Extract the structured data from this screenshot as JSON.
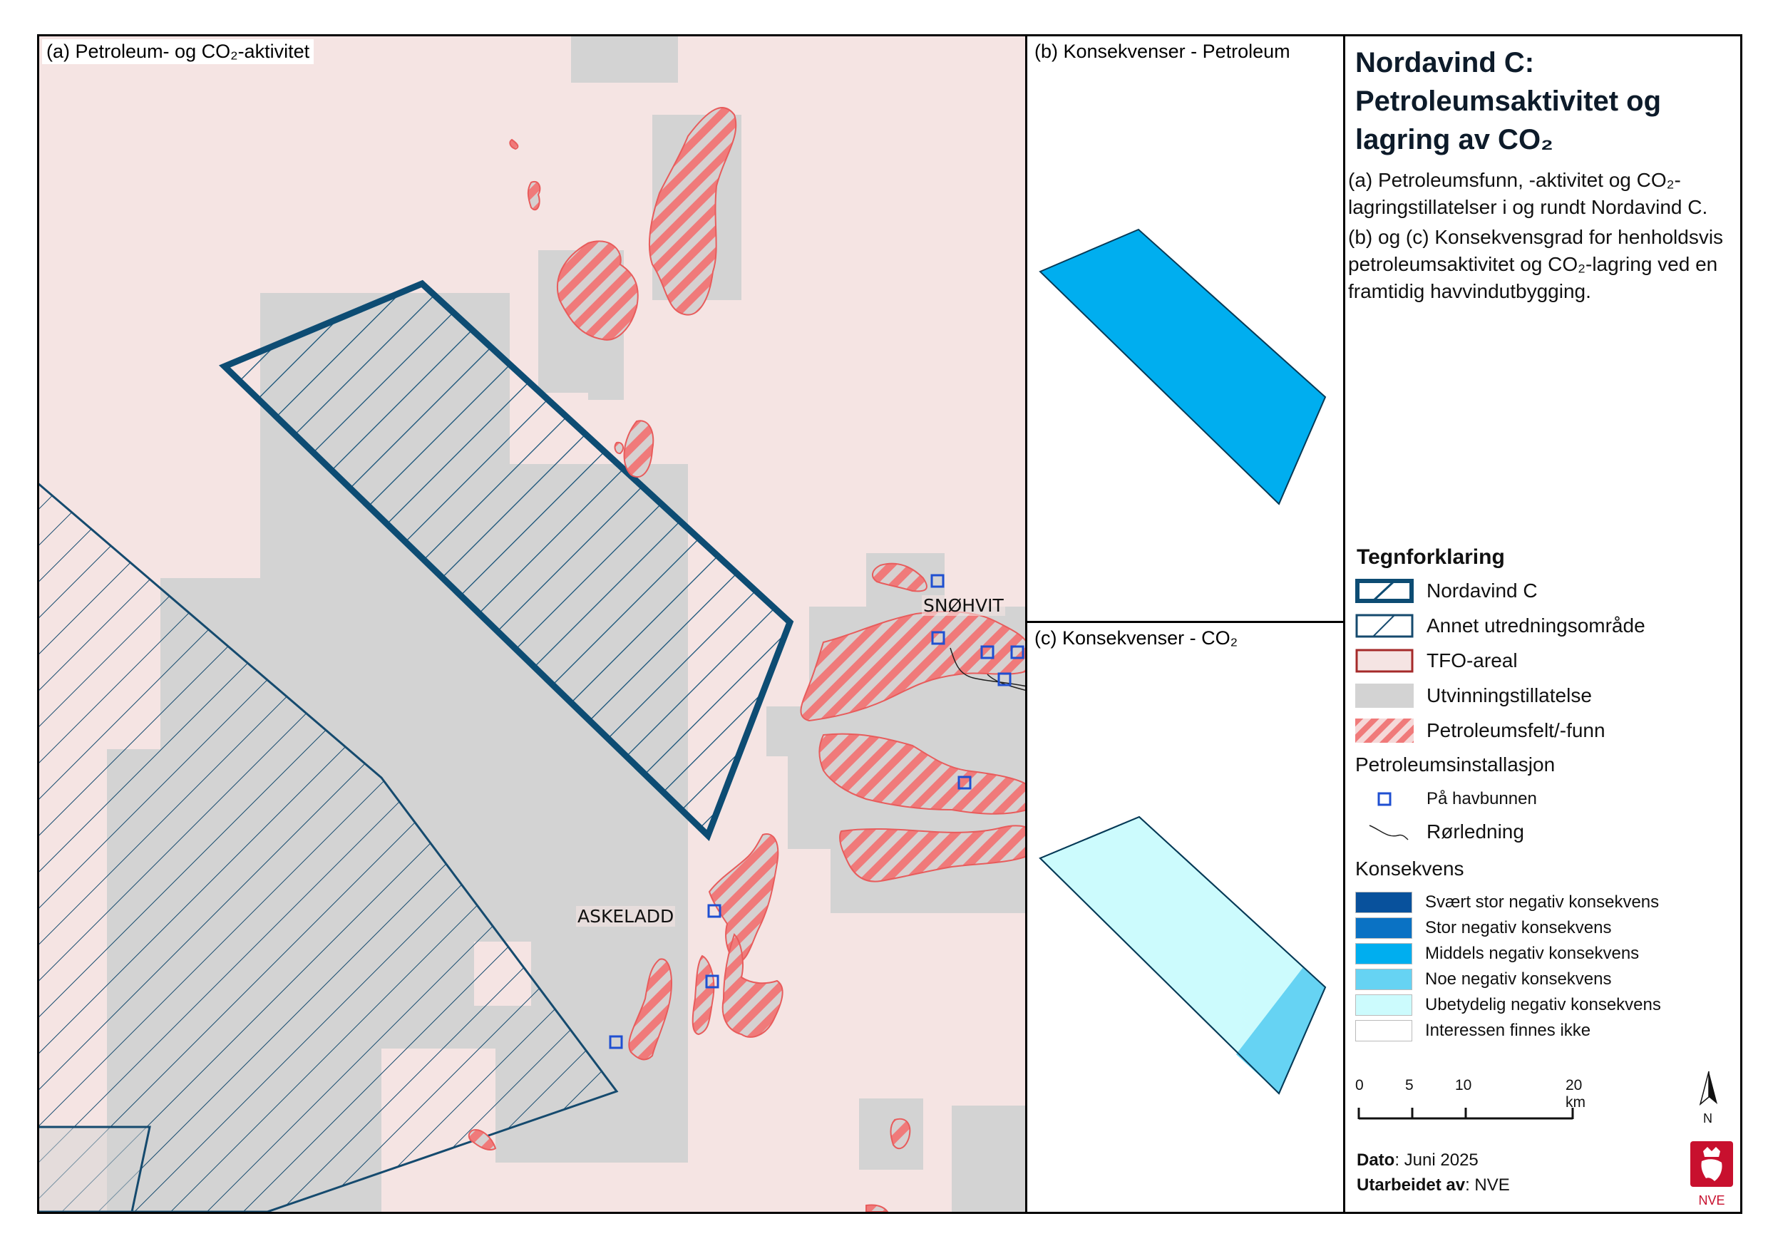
{
  "panels": {
    "a_label": "(a) Petroleum- og CO₂-aktivitet",
    "b_label": "(b) Konsekvenser - Petroleum",
    "c_label": "(c) Konsekvenser - CO₂"
  },
  "map_labels": {
    "snohvit": "SNØHVIT",
    "askeladd": "ASKELADD"
  },
  "legend": {
    "title": "Nordavind C: Petroleumsaktivitet og lagring av CO₂",
    "desc_a": "(a) Petroleumsfunn, -aktivitet og CO₂-lagringstillatelser i og rundt Nordavind C.",
    "desc_bc": "(b) og (c) Konsekvensgrad for henholdsvis petroleumsaktivitet og CO₂-lagring ved en framtidig havvindutbygging.",
    "heading": "Tegnforklaring",
    "items": [
      {
        "label": "Nordavind C",
        "icon": "nordavind-c-symbol"
      },
      {
        "label": "Annet utredningsområde",
        "icon": "annet-utredningsomrade-symbol"
      },
      {
        "label": "TFO-areal",
        "icon": "tfo-areal-symbol"
      },
      {
        "label": "Utvinningstillatelse",
        "icon": "utvinningstillatelse-symbol"
      },
      {
        "label": "Petroleumsfelt/-funn",
        "icon": "petroleumsfelt-symbol"
      }
    ],
    "installation_heading": "Petroleumsinstallasjon",
    "installation_items": [
      {
        "label": "På havbunnen",
        "icon": "subsea-square-icon"
      },
      {
        "label": "Rørledning",
        "icon": "pipeline-line-icon"
      }
    ],
    "consequence_heading": "Konsekvens",
    "consequence_items": [
      {
        "label": "Svært stor negativ konsekvens",
        "color": "#08519c"
      },
      {
        "label": "Stor negativ konsekvens",
        "color": "#0a72c4"
      },
      {
        "label": "Middels negativ konsekvens",
        "color": "#00aeef"
      },
      {
        "label": "Noe negativ konsekvens",
        "color": "#66d3f3"
      },
      {
        "label": "Ubetydelig negativ konsekvens",
        "color": "#ccfbfd"
      },
      {
        "label": "Interessen finnes ikke",
        "color": "#ffffff"
      }
    ],
    "scale": {
      "ticks": [
        "0",
        "5",
        "10",
        "20 km"
      ]
    },
    "north": "N",
    "logo_text": "NVE",
    "date_label": "Dato",
    "date_value": ": Juni 2025",
    "author_label": "Utarbeidet av",
    "author_value": ": NVE"
  },
  "colors": {
    "tfo_background": "#f5e4e3",
    "license_gray": "#d3d3d3",
    "nordavind_outline": "#0d4c73",
    "other_area_outline": "#154a6e",
    "petroleum_stripe": "#f08080",
    "installation_blue": "#1f4fd1",
    "consequence_b": "#00aeef",
    "consequence_c_main": "#ccfbfd",
    "consequence_c_corner": "#66d3f3",
    "nve_red": "#c8102e"
  }
}
